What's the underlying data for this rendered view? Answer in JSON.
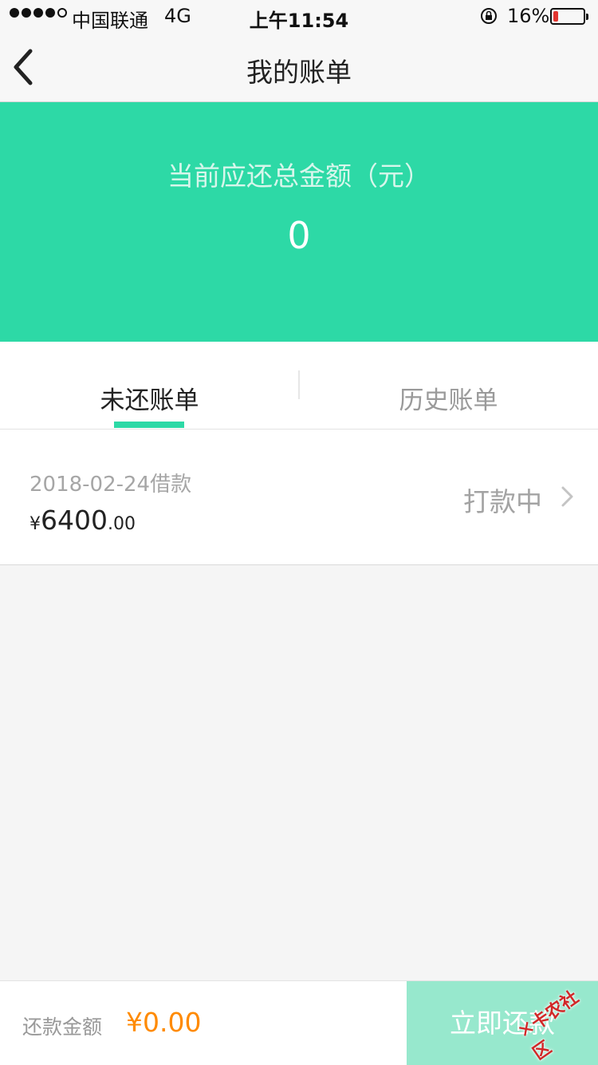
{
  "status_bar": {
    "carrier": "中国联通",
    "network": "4G",
    "time": "上午11:54",
    "battery_percent": "16%",
    "battery_level": 0.16
  },
  "nav": {
    "title": "我的账单"
  },
  "summary": {
    "label": "当前应还总金额（元）",
    "amount": "0",
    "background_color": "#2dd9a6"
  },
  "tabs": [
    {
      "label": "未还账单",
      "active": true
    },
    {
      "label": "历史账单",
      "active": false
    }
  ],
  "bills": [
    {
      "date_label": "2018-02-24借款",
      "currency": "¥",
      "amount_integer": "6400",
      "amount_decimal": ".00",
      "status": "打款中"
    }
  ],
  "footer": {
    "repay_label": "还款金额",
    "repay_amount": "¥0.00",
    "repay_button": "立即还款",
    "accent_color": "#ff8a00"
  },
  "watermark": {
    "text": "卡农社区",
    "icon": "cross-logo-icon"
  }
}
